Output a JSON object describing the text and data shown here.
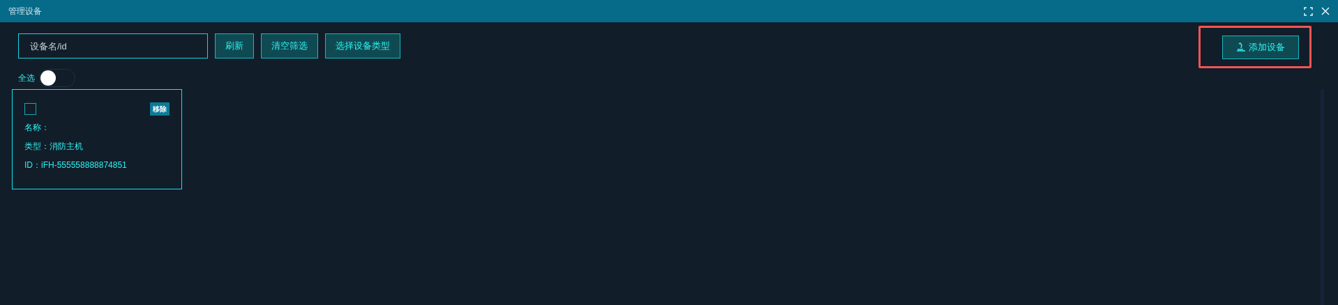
{
  "window": {
    "title": "管理设备"
  },
  "toolbar": {
    "search": {
      "placeholder": "设备名/id"
    },
    "buttons": [
      "刷新",
      "清空筛选",
      "选择设备类型"
    ],
    "add_button": {
      "label": "添加设备",
      "highlighted": true
    }
  },
  "select_all": {
    "label": "全选",
    "on": false
  },
  "devices": [
    {
      "checked": false,
      "remove_label": "移除",
      "name_label": "名称：",
      "type_label": "类型：消防主机",
      "id_label": "ID：iFH-555558888874851"
    }
  ]
}
